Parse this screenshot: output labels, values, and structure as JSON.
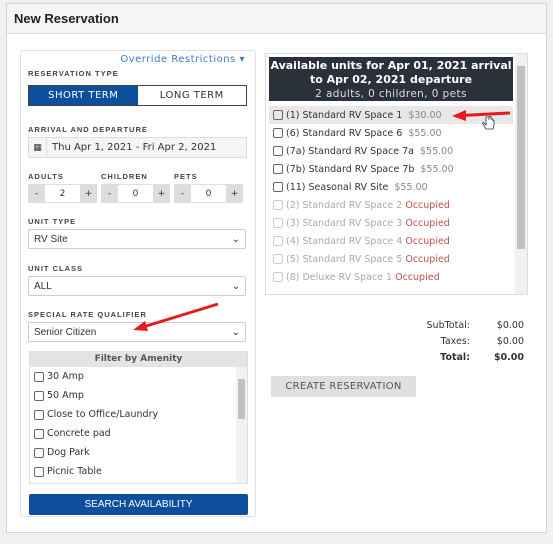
{
  "title": "New Reservation",
  "override": "Override Restrictions ▾",
  "reservation_type": {
    "label": "RESERVATION TYPE",
    "options": [
      "SHORT TERM",
      "LONG TERM"
    ],
    "selected": "SHORT TERM"
  },
  "dates": {
    "label": "ARRIVAL AND DEPARTURE",
    "value": "Thu Apr 1, 2021 - Fri Apr 2, 2021"
  },
  "guests": [
    {
      "label": "ADULTS",
      "value": "2"
    },
    {
      "label": "CHILDREN",
      "value": "0"
    },
    {
      "label": "PETS",
      "value": "0"
    }
  ],
  "unit_type": {
    "label": "UNIT TYPE",
    "value": "RV Site"
  },
  "unit_class": {
    "label": "UNIT CLASS",
    "value": "ALL"
  },
  "rate_qualifier": {
    "label": "SPECIAL RATE QUALIFIER",
    "value": "Senior Citizen"
  },
  "amenity": {
    "header": "Filter by Amenity",
    "items": [
      "30 Amp",
      "50 Amp",
      "Close to Office/Laundry",
      "Concrete pad",
      "Dog Park",
      "Picnic Table"
    ]
  },
  "search_label": "SEARCH AVAILABILITY",
  "availability": {
    "line1": "Available units for Apr 01, 2021 arrival",
    "line2": "to Apr 02, 2021 departure",
    "line3": "2 adults, 0 children, 0 pets"
  },
  "units": [
    {
      "name": "(1) Standard RV Space 1",
      "price": "$30.00"
    },
    {
      "name": "(6) Standard RV Space 6",
      "price": "$55.00"
    },
    {
      "name": "(7a) Standard RV Space 7a",
      "price": "$55.00"
    },
    {
      "name": "(7b) Standard RV Space 7b",
      "price": "$55.00"
    },
    {
      "name": "(11) Seasonal RV Site",
      "price": "$55.00"
    },
    {
      "name": "(2) Standard RV Space 2",
      "status": "Occupied"
    },
    {
      "name": "(3) Standard RV Space 3",
      "status": "Occupied"
    },
    {
      "name": "(4) Standard RV Space 4",
      "status": "Occupied"
    },
    {
      "name": "(5) Standard RV Space 5",
      "status": "Occupied"
    },
    {
      "name": "(8) Deluxe RV Space 1",
      "status": "Occupied"
    }
  ],
  "totals": {
    "subtotal_label": "SubTotal:",
    "subtotal": "$0.00",
    "taxes_label": "Taxes:",
    "taxes": "$0.00",
    "total_label": "Total:",
    "total": "$0.00"
  },
  "create_label": "CREATE RESERVATION",
  "colors": {
    "primary": "#0c4f9c",
    "occupied": "#c0504d",
    "annotation_arrow": "#e8191b"
  }
}
